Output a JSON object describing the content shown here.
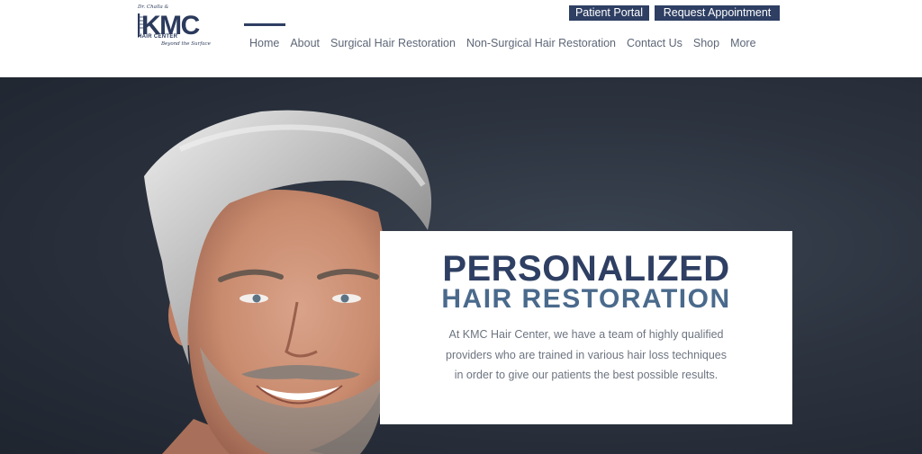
{
  "logo": {
    "doctor_text": "Dr. Challa &",
    "brand_text": "KMC",
    "sub_text": "HAIR CENTER",
    "tagline": "Beyond the Surface"
  },
  "header_buttons": {
    "patient_portal": "Patient Portal",
    "request_appointment": "Request Appointment"
  },
  "nav": {
    "items": [
      {
        "label": "Home",
        "active": true
      },
      {
        "label": "About"
      },
      {
        "label": "Surgical Hair Restoration"
      },
      {
        "label": "Non-Surgical Hair Restoration"
      },
      {
        "label": "Contact Us"
      },
      {
        "label": "Shop"
      },
      {
        "label": "More"
      }
    ]
  },
  "hero": {
    "title": "PERSONALIZED",
    "subtitle": "HAIR RESTORATION",
    "body": "At KMC Hair Center, we have a team of highly qualified providers who are trained in various hair loss techniques in order to give our patients the best possible results."
  },
  "colors": {
    "brand_navy": "#2e3f63",
    "subtitle_blue": "#4a6a8c",
    "hero_background": "#2c333f",
    "nav_text": "#5d6677"
  }
}
